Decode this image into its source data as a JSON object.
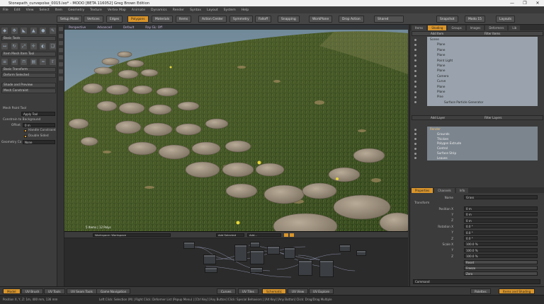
{
  "window": {
    "title": "Stonepath_curvepolse_0015.lxo* - MODO [BETA 116052] Greg Brown Edition",
    "controls": [
      "—",
      "❐",
      "✕"
    ]
  },
  "menu": [
    "File",
    "Edit",
    "View",
    "Select",
    "Item",
    "Geometry",
    "Texture",
    "Vertex Map",
    "Animate",
    "Dynamics",
    "Render",
    "Syntax",
    "Layout",
    "System",
    "Help"
  ],
  "toolbar": {
    "buttons": [
      "Setup Mode",
      "Vertices",
      "Edges",
      "Polygons",
      "Materials",
      "Items",
      "Action Center",
      "Symmetry",
      "Falloff",
      "Snapping",
      "WorkPlane",
      "Drop Action",
      "Shared",
      "Snapshot"
    ],
    "active": "Polygons",
    "right_label": "Modo 15",
    "layout_button": "Layouts"
  },
  "left_panel": {
    "section_basic": "Basic Tools",
    "row_edit": "Item Mesh Item Tool",
    "row_transform": "Basic Transform",
    "row_deform": "Deform Selected",
    "row_shade": "Shade and Preview",
    "row_constraint": "Mesh Constraint",
    "mesh_paint_tool": "Mesh Paint Tool",
    "apply_tool": "Apply Tool",
    "constrain_label": "Constrain to Background",
    "offset_label": "Offset",
    "offset_value": "0 m",
    "handle_constraint": "Handle Constraint",
    "double_sided": "Double Sided",
    "geometry_constraint_label": "Geometry Co",
    "geometry_constraint_value": "None"
  },
  "viewport": {
    "tabs": [
      "Perspective",
      "Advanced",
      "Default",
      "Ray GL: Off"
    ],
    "status_text": "5 Items | 12 Polys"
  },
  "schematic": {
    "workspace": "Workspace: Workspace",
    "filter": "Add Selected",
    "options": "Add..."
  },
  "items_panel": {
    "tabs": [
      "Items",
      "Shading",
      "Groups",
      "Images",
      "Deformers",
      "Lib"
    ],
    "active_tab": "Shading",
    "add_item": "Add Item",
    "filter_items": "Filter Items",
    "items": [
      {
        "label": "Scene",
        "indent": 0
      },
      {
        "label": "Plane",
        "indent": 1
      },
      {
        "label": "Plane",
        "indent": 1
      },
      {
        "label": "Plane",
        "indent": 1
      },
      {
        "label": "Point Light",
        "indent": 1
      },
      {
        "label": "Plane",
        "indent": 1
      },
      {
        "label": "Plane",
        "indent": 1
      },
      {
        "label": "Camera",
        "indent": 1
      },
      {
        "label": "Curve",
        "indent": 1
      },
      {
        "label": "Plane",
        "indent": 1
      },
      {
        "label": "Plane",
        "indent": 1
      },
      {
        "label": "Pine",
        "indent": 1
      },
      {
        "label": "Surface Particle Generator",
        "indent": 2
      }
    ]
  },
  "shader_panel": {
    "add_layer": "Add Layer",
    "filter_layers": "Filter Layers",
    "items": [
      {
        "label": "Render",
        "indent": 0
      },
      {
        "label": "Grounds",
        "indent": 1
      },
      {
        "label": "Thicken",
        "indent": 1
      },
      {
        "label": "Polygon Extrude",
        "indent": 1
      },
      {
        "label": "Control",
        "indent": 1
      },
      {
        "label": "Surface Strip",
        "indent": 1
      },
      {
        "label": "Leaves",
        "indent": 1
      }
    ]
  },
  "properties": {
    "tabs": [
      "Properties",
      "Channels",
      "Info"
    ],
    "name_label": "Name",
    "name_value": "Grass",
    "section": "Transform",
    "rows": [
      {
        "label": "Position X",
        "value": "0 m"
      },
      {
        "label": "Y",
        "value": "0 m"
      },
      {
        "label": "Z",
        "value": "0 m"
      },
      {
        "label": "Rotation X",
        "value": "0.0 °"
      },
      {
        "label": "Y",
        "value": "0.0 °"
      },
      {
        "label": "Z",
        "value": "0.0 °"
      },
      {
        "label": "Scale X",
        "value": "100.0 %"
      },
      {
        "label": "Y",
        "value": "100.0 %"
      },
      {
        "label": "Z",
        "value": "100.0 %"
      },
      {
        "label": "",
        "value": "Reset"
      },
      {
        "label": "",
        "value": "Freeze"
      },
      {
        "label": "",
        "value": "Zero"
      }
    ],
    "command_placeholder": "Command"
  },
  "bottom_tabs": {
    "items": [
      "Model",
      "UV Brush",
      "UV Tools",
      "UV Seam Tools",
      "Game Navigation",
      "Curves",
      "UV Tiles",
      "Schematic",
      "UV View",
      "UV Explore"
    ],
    "active": [
      "Model",
      "Schematic"
    ],
    "right_buttons": [
      "Palettes",
      "Items and Shading"
    ]
  },
  "status": {
    "left": "Position X, Y, Z:   1m, 400 mm, 136 mm",
    "hint": "Left Click: Selection (M)  |  Right Click: Deformer List (Popup Menu)  |  [Ctrl Key] [Any Button] Click: Special Behaviors  |  [Alt Key] [Any Button] Click: Drag/Drag Multiple"
  }
}
